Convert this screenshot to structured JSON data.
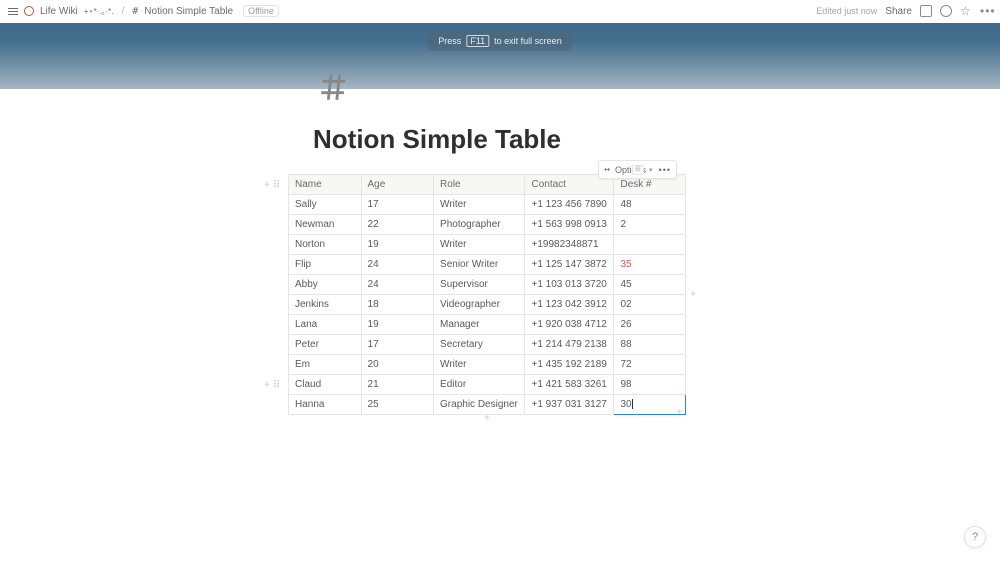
{
  "topbar": {
    "wiki": "Life Wiki",
    "wiki_suffix": "+∘*·.｡·*.",
    "separator": "/",
    "page_glyph": "#",
    "page": "Notion Simple Table",
    "offline": "Offline",
    "edited": "Edited just now",
    "share": "Share"
  },
  "fullscreen_hint": {
    "pre": "Press",
    "key": "F11",
    "post": "to exit full screen"
  },
  "page": {
    "title": "Notion Simple Table"
  },
  "options": {
    "fit_icon": "↔",
    "label": "Options",
    "more": "•••"
  },
  "table": {
    "headers": [
      "Name",
      "Age",
      "Role",
      "Contact",
      "Desk #"
    ],
    "rows": [
      {
        "name": "Sally",
        "age": "17",
        "role": "Writer",
        "contact": "+1 123 456 7890",
        "desk": "48"
      },
      {
        "name": "Newman",
        "age": "22",
        "role": "Photographer",
        "contact": "+1 563 998 0913",
        "desk": "2"
      },
      {
        "name": "Norton",
        "age": "19",
        "role": "Writer",
        "contact": "+19982348871",
        "desk": ""
      },
      {
        "name": "Flip",
        "age": "24",
        "role": "Senior Writer",
        "contact": "+1 125 147 3872",
        "desk": "35",
        "desk_highlight": true
      },
      {
        "name": "Abby",
        "age": "24",
        "role": "Supervisor",
        "contact": "+1 103 013 3720",
        "desk": "45"
      },
      {
        "name": "Jenkins",
        "age": "18",
        "role": "Videographer",
        "contact": "+1 123 042 3912",
        "desk": "02"
      },
      {
        "name": "Lana",
        "age": "19",
        "role": "Manager",
        "contact": "+1 920 038 4712",
        "desk": "26"
      },
      {
        "name": "Peter",
        "age": "17",
        "role": "Secretary",
        "contact": "+1 214 479 2138",
        "desk": "88"
      },
      {
        "name": "Em",
        "age": "20",
        "role": "Writer",
        "contact": "+1 435 192 2189",
        "desk": "72"
      },
      {
        "name": "Claud",
        "age": "21",
        "role": "Editor",
        "contact": "+1 421 583 3261",
        "desk": "98"
      },
      {
        "name": "Hanna",
        "age": "25",
        "role": "Graphic Designer",
        "contact": "+1 937 031 3127",
        "desk": "30",
        "editing": true
      }
    ]
  },
  "help": "?"
}
